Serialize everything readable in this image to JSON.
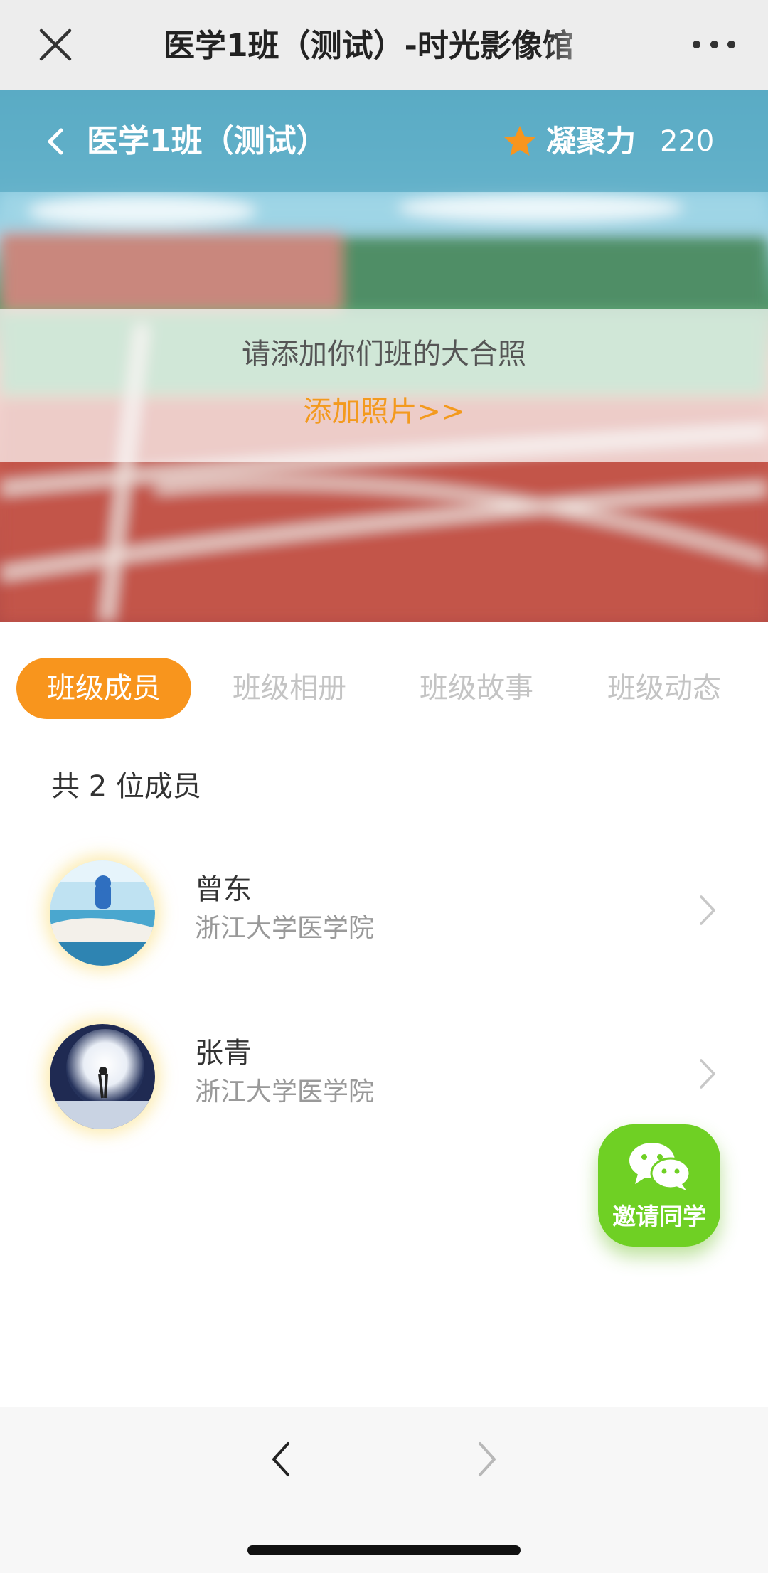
{
  "topbar": {
    "title": "医学1班（测试）-时光影像馆",
    "close_icon": "close-icon",
    "more_icon": "more-icon"
  },
  "hero": {
    "class_name": "医学1班（测试）",
    "cohesion_label": "凝聚力",
    "cohesion_value": "220",
    "prompt": "请添加你们班的大合照",
    "add_photo": "添加照片>>"
  },
  "tabs": [
    {
      "label": "班级成员",
      "active": true
    },
    {
      "label": "班级相册",
      "active": false
    },
    {
      "label": "班级故事",
      "active": false
    },
    {
      "label": "班级动态",
      "active": false
    }
  ],
  "members": {
    "count_text": "共 2 位成员",
    "items": [
      {
        "name": "曾东",
        "school": "浙江大学医学院"
      },
      {
        "name": "张青",
        "school": "浙江大学医学院"
      }
    ]
  },
  "invite": {
    "label": "邀请同学"
  },
  "colors": {
    "accent_orange": "#f8951d",
    "invite_green": "#6fd024",
    "topbar_bg": "#ededed"
  }
}
